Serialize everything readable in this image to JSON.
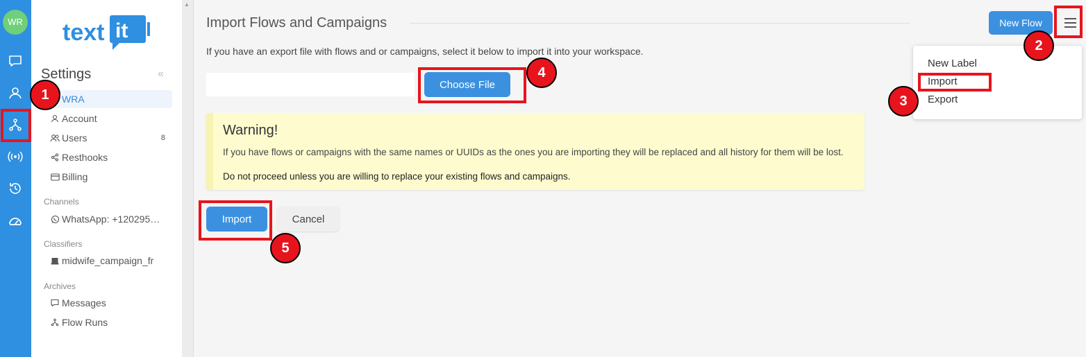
{
  "rail": {
    "avatar_initials": "WR",
    "icons": [
      "chat-icon",
      "contacts-icon",
      "flows-icon",
      "channels-icon",
      "history-icon",
      "dashboard-icon"
    ]
  },
  "sidebar": {
    "logo_text": "textit",
    "title": "Settings",
    "collapse_glyph": "«",
    "items": [
      {
        "label": "WRA",
        "icon": ""
      },
      {
        "label": "Account",
        "icon": "user-icon"
      },
      {
        "label": "Users",
        "icon": "users-icon",
        "badge": "8"
      },
      {
        "label": "Resthooks",
        "icon": "share-icon"
      },
      {
        "label": "Billing",
        "icon": "card-icon"
      }
    ],
    "channels_heading": "Channels",
    "channel_item": "WhatsApp: +120295…",
    "classifiers_heading": "Classifiers",
    "classifier_item": "midwife_campaign_fr",
    "archives_heading": "Archives",
    "archive_items": [
      "Messages",
      "Flow Runs"
    ]
  },
  "main": {
    "title": "Import Flows and Campaigns",
    "intro": "If you have an export file with flows and or campaigns, select it below to import it into your workspace.",
    "choose_file_label": "Choose File",
    "warning": {
      "title": "Warning!",
      "text1": "If you have flows or campaigns with the same names or UUIDs as the ones you are importing they will be replaced and all history for them will be lost.",
      "text2": "Do not proceed unless you are willing to replace your existing flows and campaigns."
    },
    "import_label": "Import",
    "cancel_label": "Cancel"
  },
  "header": {
    "new_flow_label": "New Flow"
  },
  "dropdown": {
    "items": [
      "New Label",
      "Import",
      "Export"
    ]
  },
  "annotations": {
    "step1": "1",
    "step2": "2",
    "step3": "3",
    "step4": "4",
    "step5": "5"
  },
  "colors": {
    "primary": "#3b91e0",
    "rail": "#2f8fe0",
    "highlight": "#e8141d",
    "warning_bg": "#fefccf"
  }
}
